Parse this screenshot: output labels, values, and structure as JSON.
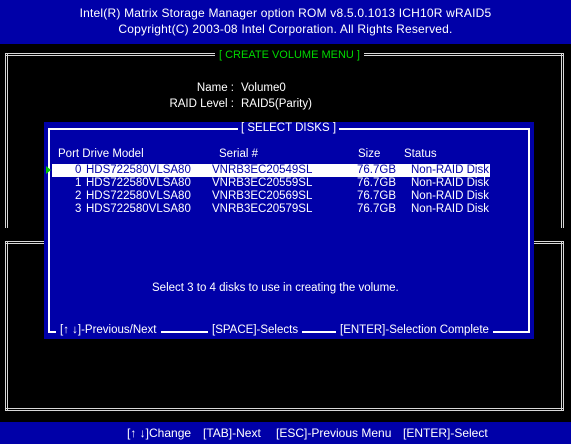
{
  "header": {
    "line1": "Intel(R) Matrix Storage Manager option ROM v8.5.0.1013 ICH10R wRAID5",
    "line2": "Copyright(C) 2003-08 Intel Corporation.  All Rights Reserved."
  },
  "create_volume": {
    "title": "[ CREATE VOLUME MENU ]",
    "name_label": "Name :",
    "name_value": "Volume0",
    "raid_label": "RAID Level :",
    "raid_value": "RAID5(Parity)"
  },
  "select_disks": {
    "title": "[ SELECT DISKS ]",
    "columns": [
      "Port Drive Model",
      "Serial #",
      "Size",
      "Status"
    ],
    "disks": [
      {
        "port": "0",
        "model": "HDS722580VLSA80",
        "serial": "VNRB3EC20549SL",
        "size": "76.7GB",
        "status": "Non-RAID Disk"
      },
      {
        "port": "1",
        "model": "HDS722580VLSA80",
        "serial": "VNRB3EC20559SL",
        "size": "76.7GB",
        "status": "Non-RAID Disk"
      },
      {
        "port": "2",
        "model": "HDS722580VLSA80",
        "serial": "VNRB3EC20569SL",
        "size": "76.7GB",
        "status": "Non-RAID Disk"
      },
      {
        "port": "3",
        "model": "HDS722580VLSA80",
        "serial": "VNRB3EC20579SL",
        "size": "76.7GB",
        "status": "Non-RAID Disk"
      }
    ],
    "message": "Select 3 to 4 disks to use in creating the volume.",
    "hints": {
      "nav": "[↑ ↓]-Previous/Next",
      "space": "[SPACE]-Selects",
      "enter": "[ENTER]-Selection Complete"
    }
  },
  "footer": {
    "change": "[↑ ↓]Change",
    "tab": "[TAB]-Next",
    "esc": "[ESC]-Previous Menu",
    "enter": "[ENTER]-Select"
  },
  "colors": {
    "bios_blue": "#0000a8",
    "title_green": "#00d800",
    "selection_bg": "#ffffff",
    "frame": "#d8d8d8"
  }
}
